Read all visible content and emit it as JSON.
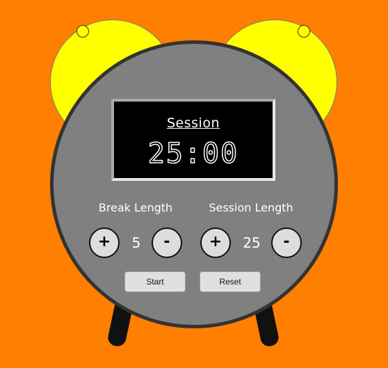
{
  "timer": {
    "label": "Session",
    "display": "25:00"
  },
  "break": {
    "label": "Break Length",
    "value": "5",
    "increment_label": "+",
    "decrement_label": "-"
  },
  "session": {
    "label": "Session Length",
    "value": "25",
    "increment_label": "+",
    "decrement_label": "-"
  },
  "controls": {
    "start_label": "Start",
    "reset_label": "Reset"
  },
  "colors": {
    "background": "#FF7F00",
    "bells": "#FFFF00",
    "body": "#808080",
    "screen": "#000000"
  }
}
